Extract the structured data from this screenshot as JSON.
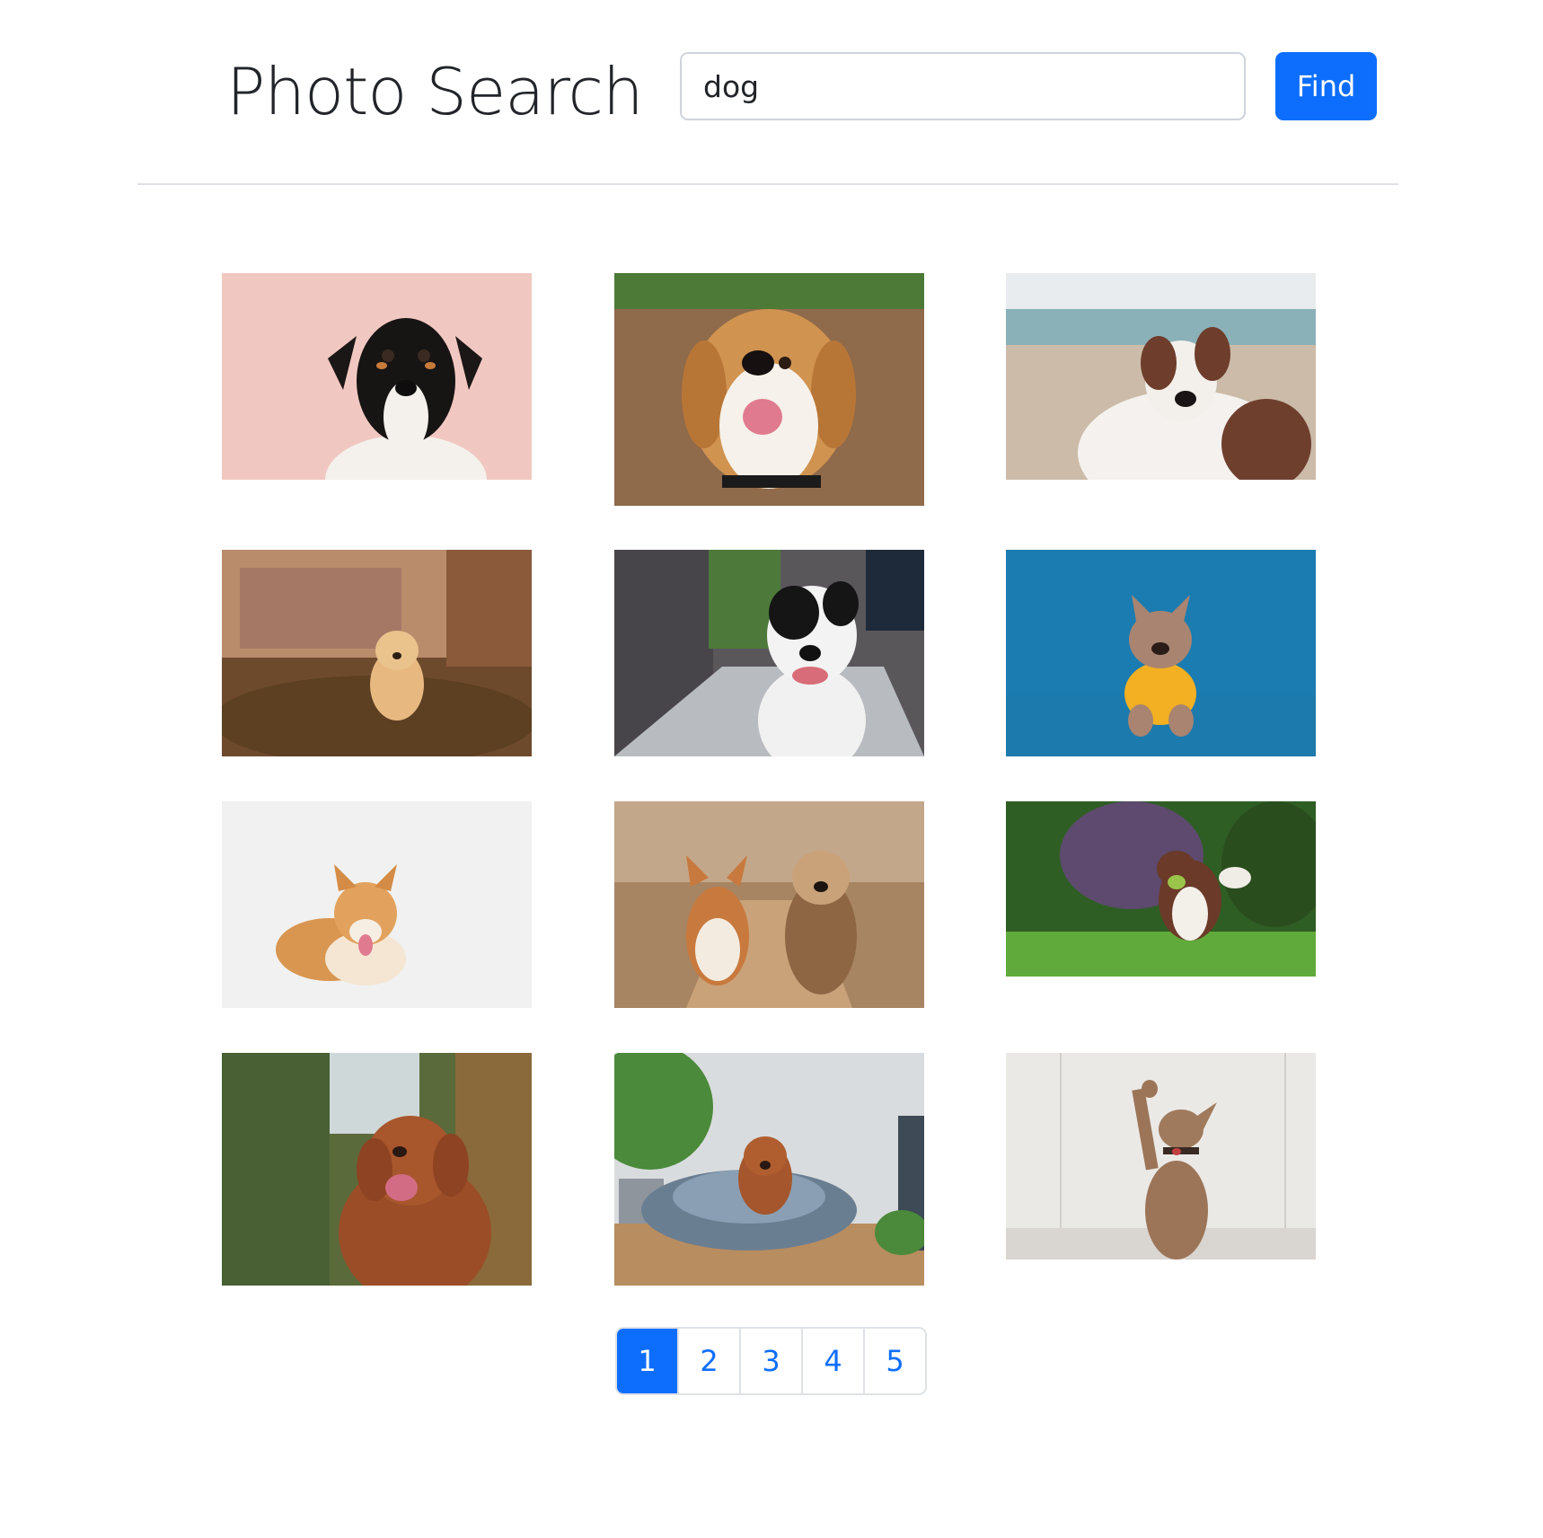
{
  "header": {
    "title": "Photo Search",
    "search_value": "dog",
    "find_label": "Find"
  },
  "photos": [
    {
      "subject": "terrier-portrait",
      "bg": "#f2c9c2",
      "accent": "#1e1a1a"
    },
    {
      "subject": "beagle-smiling",
      "bg": "#8e6a4a",
      "accent": "#d79b57"
    },
    {
      "subject": "australian-shepherd",
      "bg": "#cbbfae",
      "accent": "#7a4a32"
    },
    {
      "subject": "golden-puppy-running",
      "bg": "#6b4a2e",
      "accent": "#e6b77b"
    },
    {
      "subject": "jack-russell-sidewalk",
      "bg": "#5d5a5f",
      "accent": "#f3f3f3"
    },
    {
      "subject": "french-bulldog-yellow-shirt",
      "bg": "#1b7fb5",
      "accent": "#f2b122"
    },
    {
      "subject": "corgi-lying",
      "bg": "#f1f1f1",
      "accent": "#d9944f"
    },
    {
      "subject": "corgi-and-yorkie",
      "bg": "#b08a66",
      "accent": "#c97a3e"
    },
    {
      "subject": "border-collie-grass",
      "bg": "#3e7f2c",
      "accent": "#6b3b2a"
    },
    {
      "subject": "toller-field",
      "bg": "#5b6e3c",
      "accent": "#a5562c"
    },
    {
      "subject": "toller-dog-bed",
      "bg": "#d7dadc",
      "accent": "#6d7f90"
    },
    {
      "subject": "dog-waving-paw",
      "bg": "#e9e7e4",
      "accent": "#9a7559"
    }
  ],
  "pagination": {
    "pages": [
      "1",
      "2",
      "3",
      "4",
      "5"
    ],
    "active": "1"
  },
  "colors": {
    "primary": "#0d6efd",
    "border": "#dee2e6"
  }
}
